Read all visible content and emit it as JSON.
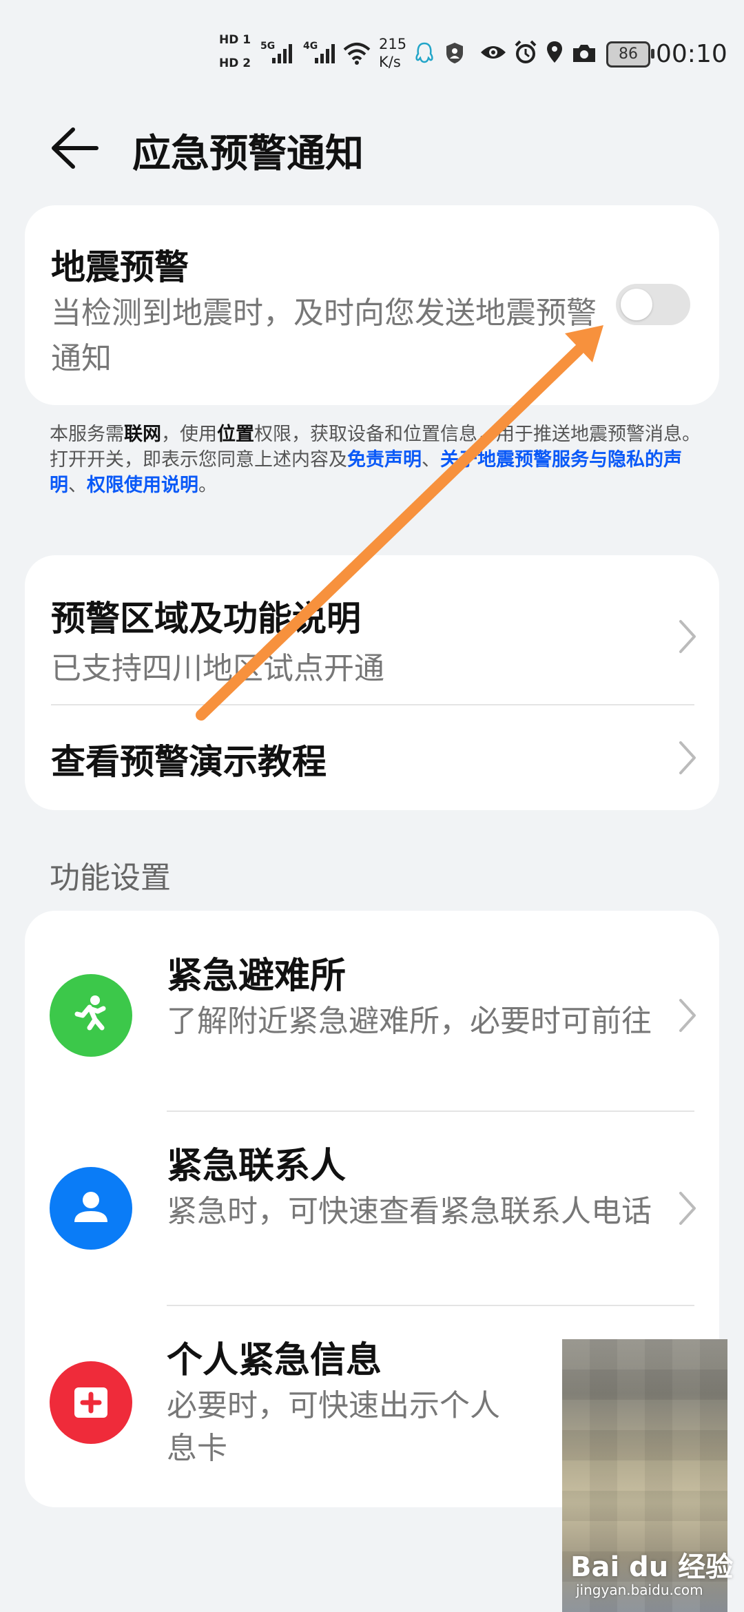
{
  "status_bar": {
    "hd1": "HD 1",
    "hd2": "HD 2",
    "sim1": "5G",
    "sim2": "4G",
    "speed_value": "215",
    "speed_unit": "K/s",
    "battery": "86",
    "time": "00:10"
  },
  "header": {
    "title": "应急预警通知"
  },
  "earthquake": {
    "title": "地震预警",
    "desc": "当检测到地震时，及时向您发送地震预警通知",
    "toggle_on": false
  },
  "notice": {
    "p1": "本服务需",
    "b1": "联网",
    "p2": "，使用",
    "b2": "位置",
    "p3": "权限，获取设备和位置信息，用于推送地震预警消息。打开开关，即表示您同意上述内容及",
    "l1": "免责声明",
    "sep1": "、",
    "l2": "关于地震预警服务与隐私的声明",
    "sep2": "、",
    "l3": "权限使用说明",
    "end": "。"
  },
  "info_card": {
    "region_title": "预警区域及功能说明",
    "region_sub": "已支持四川地区试点开通",
    "tutorial_title": "查看预警演示教程"
  },
  "section_title": "功能设置",
  "features": [
    {
      "title": "紧急避难所",
      "desc": "了解附近紧急避难所，必要时可前往",
      "icon": "running-person-icon",
      "color": "#3cc84a"
    },
    {
      "title": "紧急联系人",
      "desc": "紧急时，可快速查看紧急联系人电话",
      "icon": "person-icon",
      "color": "#0a7cf7"
    },
    {
      "title": "个人紧急信息",
      "desc": "必要时，可快速出示个人",
      "desc_line2": "息卡",
      "icon": "medical-cross-icon",
      "color": "#ef2b3a"
    }
  ],
  "watermark": {
    "brand": "Bai du 经验",
    "url": "jingyan.baidu.com"
  },
  "colors": {
    "link": "#0a59f7",
    "annotation_arrow": "#f7913d"
  }
}
